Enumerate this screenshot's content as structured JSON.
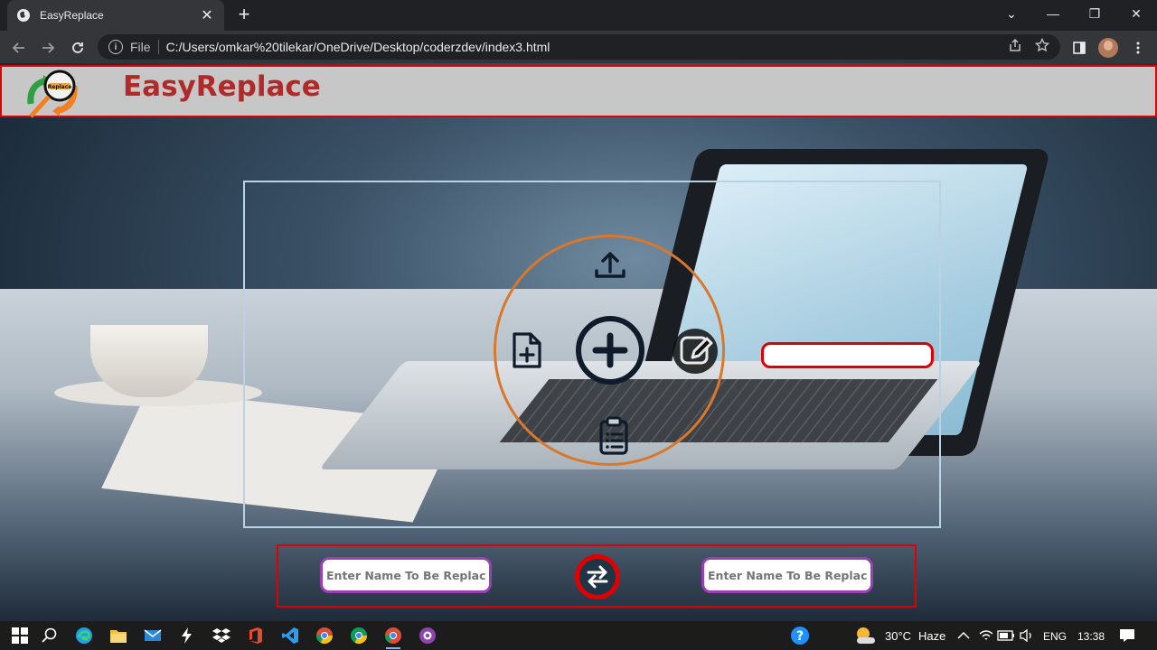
{
  "browser": {
    "tab_title": "EasyReplace",
    "tab_close": "✕",
    "new_tab": "+",
    "scheme_label": "File",
    "url": "C:/Users/omkar%20tilekar/OneDrive/Desktop/coderzdev/index3.html",
    "window_controls": [
      "⌄",
      "—",
      "❐",
      "✕"
    ]
  },
  "page": {
    "brand": "EasyReplace",
    "logo_label": "Replace",
    "tools": [
      "upload-icon",
      "add-file-icon",
      "plus-circle-icon",
      "edit-icon",
      "clipboard-list-icon"
    ],
    "input_left_placeholder": "Enter Name To Be Replaced",
    "input_right_placeholder": "Enter Name To Be Replaced",
    "swap_icon": "swap-arrows-icon",
    "colors": {
      "header_bg": "#c7c7c7",
      "brand_text": "#b02a2a",
      "accent_red": "#e00000",
      "orbit_orange": "#d9782c",
      "input_border": "#9b3fb5",
      "icon_dark": "#0f1b2a"
    }
  },
  "taskbar": {
    "temperature": "30°C",
    "weather": "Haze",
    "language": "ENG",
    "time": "13:38"
  }
}
